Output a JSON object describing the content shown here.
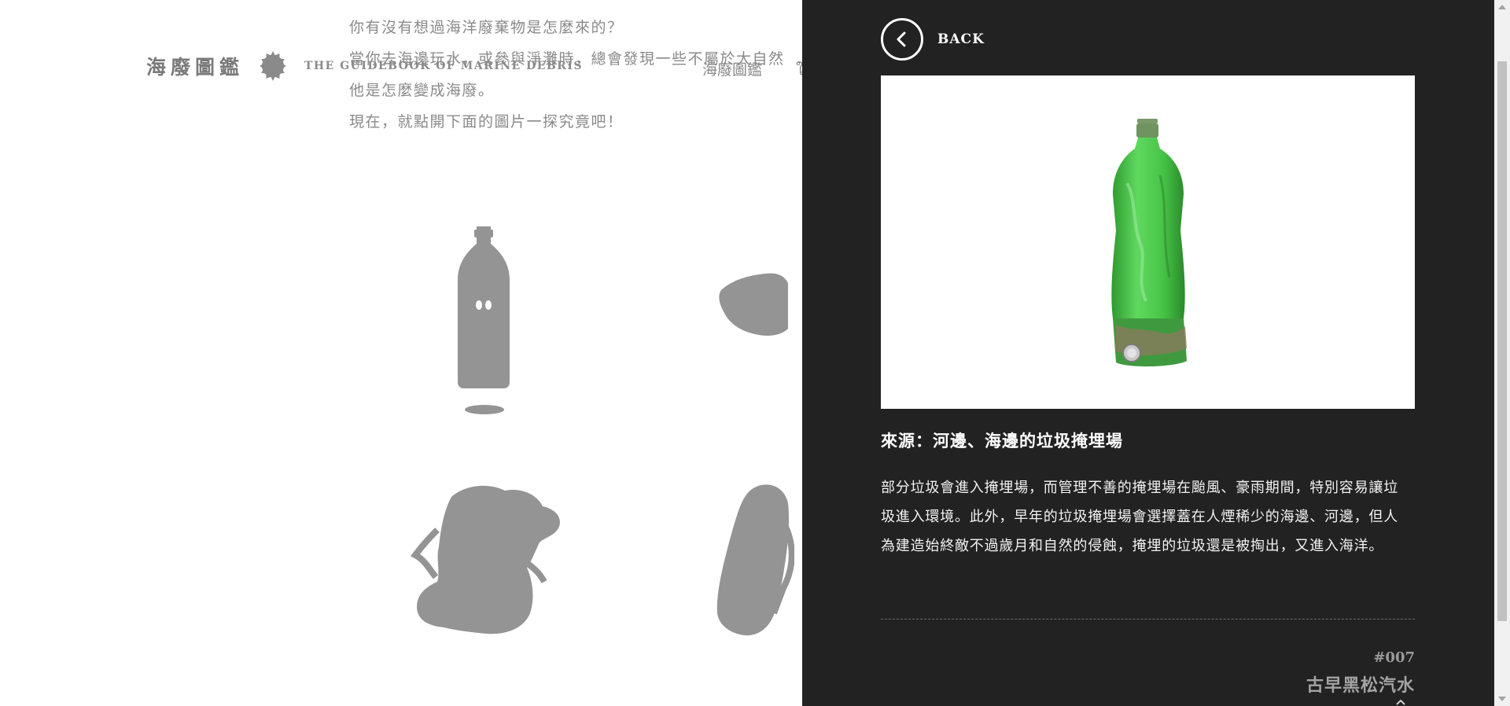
{
  "site": {
    "logo_title": "海廢圖鑑",
    "logo_subtitle": "THE GUIDEBOOK OF MARINE DEBRIS",
    "nav_link": "海廢圖鑑",
    "nav_link_partial": "ใ"
  },
  "intro": {
    "lines": [
      "你有沒有想過海洋廢棄物是怎麼來的？",
      "當你去海邊玩水，或參與淨灘時，總會發現一些不屬於大自然",
      "他是怎麼變成海廢。",
      "現在，就點開下面的圖片一探究竟吧！"
    ]
  },
  "gallery": {
    "items": [
      {
        "icon": "bottle-silhouette-icon"
      },
      {
        "icon": "fabric-silhouette-icon"
      },
      {
        "icon": "backpack-silhouette-icon"
      },
      {
        "icon": "flip-flop-silhouette-icon"
      }
    ]
  },
  "detail": {
    "back_label": "BACK",
    "photo": {
      "icon": "green-plastic-bottle-photo",
      "accent": "#4fcf4f"
    },
    "source_title": "來源：河邊、海邊的垃圾掩埋場",
    "description": "部分垃圾會進入掩埋場，而管理不善的掩埋場在颱風、豪雨期間，特別容易讓垃圾進入環境。此外，早年的垃圾掩埋場會選擇蓋在人煙稀少的海邊、河邊，但人為建造始終敵不過歲月和自然的侵蝕，掩埋的垃圾還是被掏出，又進入海洋。",
    "item_number": "#007",
    "item_name": "古早黑松汽水"
  },
  "colors": {
    "panel_bg": "#222222",
    "silhouette": "#949494",
    "muted_text": "#8a8a8a"
  }
}
